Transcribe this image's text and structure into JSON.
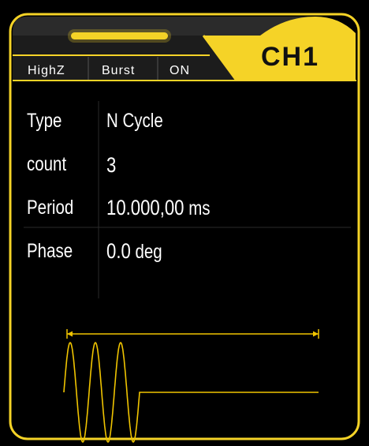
{
  "header": {
    "channel": "CH1",
    "tabs": [
      "HighZ",
      "Burst",
      "ON"
    ]
  },
  "params": [
    {
      "label": "Type",
      "value": "N Cycle",
      "unit": ""
    },
    {
      "label": "count",
      "value": "3",
      "unit": ""
    },
    {
      "label": "Period",
      "value": "10.000,00",
      "unit": "ms"
    },
    {
      "label": "Phase",
      "value": "0.0",
      "unit": "deg"
    }
  ],
  "colors": {
    "accent": "#f5d327",
    "background": "#000000",
    "text": "#ffffff",
    "wave": "#f0c400"
  },
  "waveform": {
    "type": "burst-sine",
    "cycles": 3
  }
}
